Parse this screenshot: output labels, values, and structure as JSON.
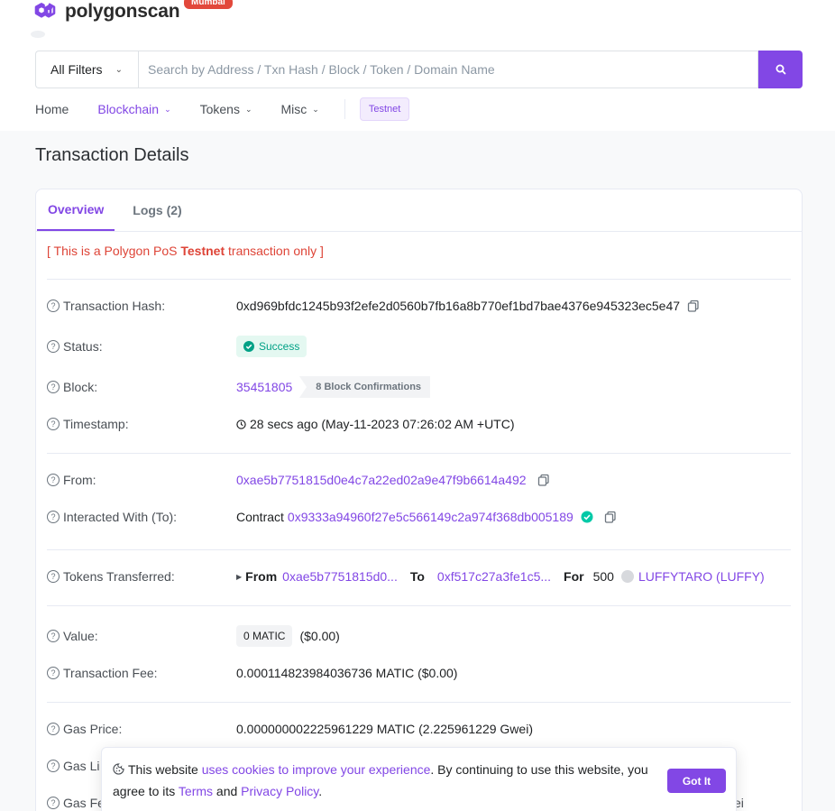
{
  "brand": {
    "name": "polygonscan",
    "badge": "Mumbai"
  },
  "search": {
    "filter_label": "All Filters",
    "placeholder": "Search by Address / Txn Hash / Block / Token / Domain Name"
  },
  "nav": {
    "home": "Home",
    "blockchain": "Blockchain",
    "tokens": "Tokens",
    "misc": "Misc",
    "testnet": "Testnet"
  },
  "page": {
    "title": "Transaction Details"
  },
  "tabs": {
    "overview": "Overview",
    "logs": "Logs (2)"
  },
  "notice": {
    "prefix": "[ This is a Polygon PoS ",
    "highlight": "Testnet",
    "suffix": " transaction only ]"
  },
  "tx": {
    "hash_label": "Transaction Hash:",
    "hash": "0xd969bfdc1245b93f2efe2d0560b7fb16a8b770ef1bd7bae4376e945323ec5e47",
    "status_label": "Status:",
    "status": "Success",
    "block_label": "Block:",
    "block": "35451805",
    "confirmations": "8 Block Confirmations",
    "timestamp_label": "Timestamp:",
    "timestamp": "28 secs ago (May-11-2023 07:26:02 AM +UTC)",
    "from_label": "From:",
    "from": "0xae5b7751815d0e4c7a22ed02a9e47f9b6614a492",
    "to_label": "Interacted With (To):",
    "to_prefix": "Contract",
    "to": "0x9333a94960f27e5c566149c2a974f368db005189",
    "tokens_label": "Tokens Transferred:",
    "transfer": {
      "from_label": "From",
      "from": "0xae5b7751815d0...",
      "to_label": "To",
      "to": "0xf517c27a3fe1c5...",
      "for_label": "For",
      "amount": "500",
      "token": "LUFFYTARO (LUFFY)"
    },
    "value_label": "Value:",
    "value_badge": "0 MATIC",
    "value_usd": "($0.00)",
    "fee_label": "Transaction Fee:",
    "fee": "0.000114823984036736 MATIC ($0.00)",
    "gas_price_label": "Gas Price:",
    "gas_price": "0.000000002225961229 MATIC (2.225961229 Gwei)",
    "gas_limit_label_partial": "Gas Li",
    "gas_fees_label_partial": "Gas Fe",
    "gas_fees_tail": "ei"
  },
  "cookie": {
    "text1": "This website ",
    "link1": "uses cookies to improve your experience",
    "text2": ". By continuing to use this website, you agree to its ",
    "link2": "Terms",
    "text3": " and ",
    "link3": "Privacy Policy",
    "text4": ".",
    "button": "Got It"
  },
  "colors": {
    "accent": "#8247e5",
    "danger": "#de4437",
    "success": "#00a186",
    "brand_badge": "#e2483b"
  }
}
